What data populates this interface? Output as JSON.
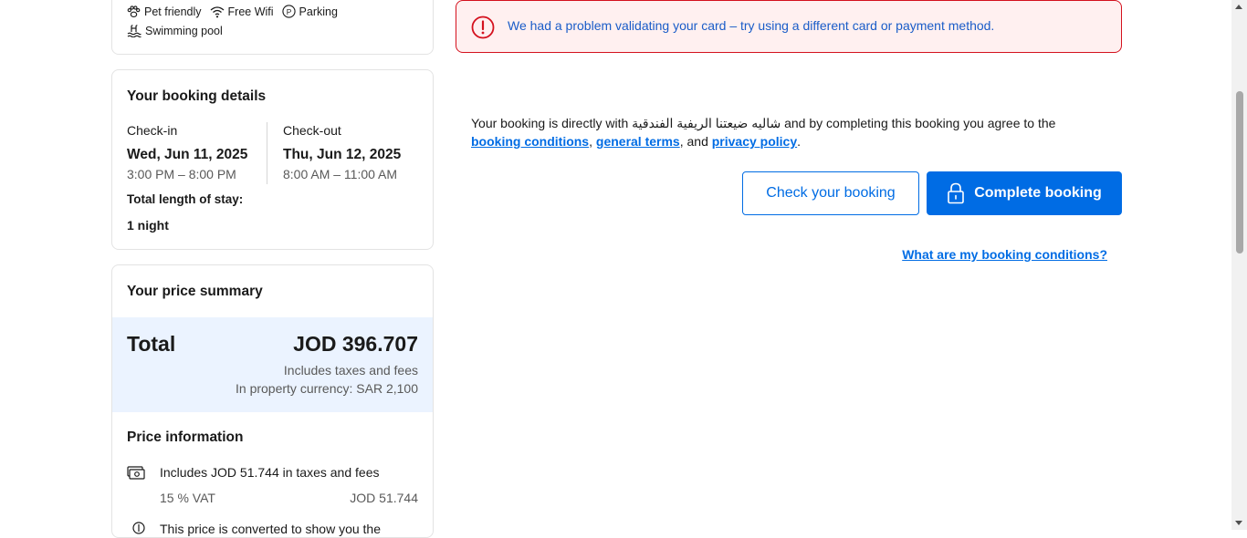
{
  "facilities": {
    "items": [
      "Pet friendly",
      "Free Wifi",
      "Parking",
      "Swimming pool"
    ]
  },
  "booking_details": {
    "title": "Your booking details",
    "checkin_label": "Check-in",
    "checkin_date": "Wed, Jun 11, 2025",
    "checkin_time": "3:00 PM – 8:00 PM",
    "checkout_label": "Check-out",
    "checkout_date": "Thu, Jun 12, 2025",
    "checkout_time": "8:00 AM – 11:00 AM",
    "length_label": "Total length of stay:",
    "length_value": "1 night"
  },
  "price_summary": {
    "title": "Your price summary",
    "total_label": "Total",
    "total_value": "JOD 396.707",
    "includes": "Includes taxes and fees",
    "property_currency": "In property currency: SAR 2,100",
    "info_title": "Price information",
    "taxes_line": "Includes JOD 51.744 in taxes and fees",
    "vat_label": "15 % VAT",
    "vat_value": "JOD 51.744",
    "converted_note": "This price is converted to show you the"
  },
  "alert": {
    "message": "We had a problem validating your card – try using a different card or payment method.",
    "color": "#d4111e"
  },
  "agreement": {
    "prefix": "Your booking is directly with ",
    "property_name": "شاليه ضيعتنا الريفية الفندقية",
    "middle": " and by completing this booking you agree to the",
    "booking_conditions": "booking conditions",
    "comma": ", ",
    "general_terms": "general terms",
    "and": ", and ",
    "privacy_policy": "privacy policy",
    "period": "."
  },
  "actions": {
    "check_booking": "Check your booking",
    "complete_booking": "Complete booking",
    "conditions_link": "What are my booking conditions?",
    "accent": "#006ce4"
  },
  "icons": [
    "paw-icon",
    "wifi-icon",
    "parking-icon",
    "pool-icon",
    "alert-icon",
    "lock-icon",
    "money-icon",
    "info-icon"
  ]
}
